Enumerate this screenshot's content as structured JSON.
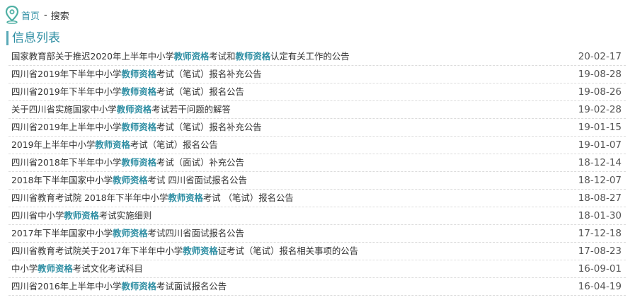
{
  "breadcrumb": {
    "home": "首页",
    "separator": "-",
    "current": "搜索"
  },
  "list_title": "信息列表",
  "items": [
    {
      "parts": [
        [
          "国家教育部关于推迟2020年上半年中小学",
          false
        ],
        [
          "教师资格",
          true
        ],
        [
          "考试和",
          false
        ],
        [
          "教师资格",
          true
        ],
        [
          "认定有关工作的公告",
          false
        ]
      ],
      "date": "20-02-17"
    },
    {
      "parts": [
        [
          "四川省2019年下半年中小学",
          false
        ],
        [
          "教师资格",
          true
        ],
        [
          "考试（笔试）报名补充公告",
          false
        ]
      ],
      "date": "19-08-28"
    },
    {
      "parts": [
        [
          "四川省2019年下半年中小学",
          false
        ],
        [
          "教师资格",
          true
        ],
        [
          "考试（笔试）报名公告",
          false
        ]
      ],
      "date": "19-08-26"
    },
    {
      "parts": [
        [
          "关于四川省实施国家中小学",
          false
        ],
        [
          "教师资格",
          true
        ],
        [
          "考试若干问题的解答",
          false
        ]
      ],
      "date": "19-02-28"
    },
    {
      "parts": [
        [
          "四川省2019年上半年中小学",
          false
        ],
        [
          "教师资格",
          true
        ],
        [
          "考试（笔试）报名补充公告",
          false
        ]
      ],
      "date": "19-01-15"
    },
    {
      "parts": [
        [
          "2019年上半年中小学",
          false
        ],
        [
          "教师资格",
          true
        ],
        [
          "考试（笔试）报名公告",
          false
        ]
      ],
      "date": "19-01-07"
    },
    {
      "parts": [
        [
          "四川省2018年下半年中小学",
          false
        ],
        [
          "教师资格",
          true
        ],
        [
          "考试（面试）补充公告",
          false
        ]
      ],
      "date": "18-12-14"
    },
    {
      "parts": [
        [
          "2018年下半年国家中小学",
          false
        ],
        [
          "教师资格",
          true
        ],
        [
          "考试 四川省面试报名公告",
          false
        ]
      ],
      "date": "18-12-07"
    },
    {
      "parts": [
        [
          "四川省教育考试院 2018年下半年中小学",
          false
        ],
        [
          "教师资格",
          true
        ],
        [
          "考试 （笔试）报名公告",
          false
        ]
      ],
      "date": "18-08-27"
    },
    {
      "parts": [
        [
          "四川省中小学",
          false
        ],
        [
          "教师资格",
          true
        ],
        [
          "考试实施细则",
          false
        ]
      ],
      "date": "18-01-30"
    },
    {
      "parts": [
        [
          "2017年下半年国家中小学",
          false
        ],
        [
          "教师资格",
          true
        ],
        [
          "考试四川省面试报名公告",
          false
        ]
      ],
      "date": "17-12-18"
    },
    {
      "parts": [
        [
          "四川省教育考试院关于2017年下半年中小学",
          false
        ],
        [
          "教师资格",
          true
        ],
        [
          "证考试（笔试）报名相关事项的公告",
          false
        ]
      ],
      "date": "17-08-23"
    },
    {
      "parts": [
        [
          "中小学",
          false
        ],
        [
          "教师资格",
          true
        ],
        [
          "考试文化考试科目",
          false
        ]
      ],
      "date": "16-09-01"
    },
    {
      "parts": [
        [
          "四川省2016年上半年中小学",
          false
        ],
        [
          "教师资格",
          true
        ],
        [
          "考试面试报名公告",
          false
        ]
      ],
      "date": "16-04-19"
    }
  ],
  "colors": {
    "accent": "#2e8ea3",
    "pin": "#4fb0a4",
    "divider": "#dcdcdc"
  },
  "icons": {
    "location": "map-pin-icon"
  }
}
